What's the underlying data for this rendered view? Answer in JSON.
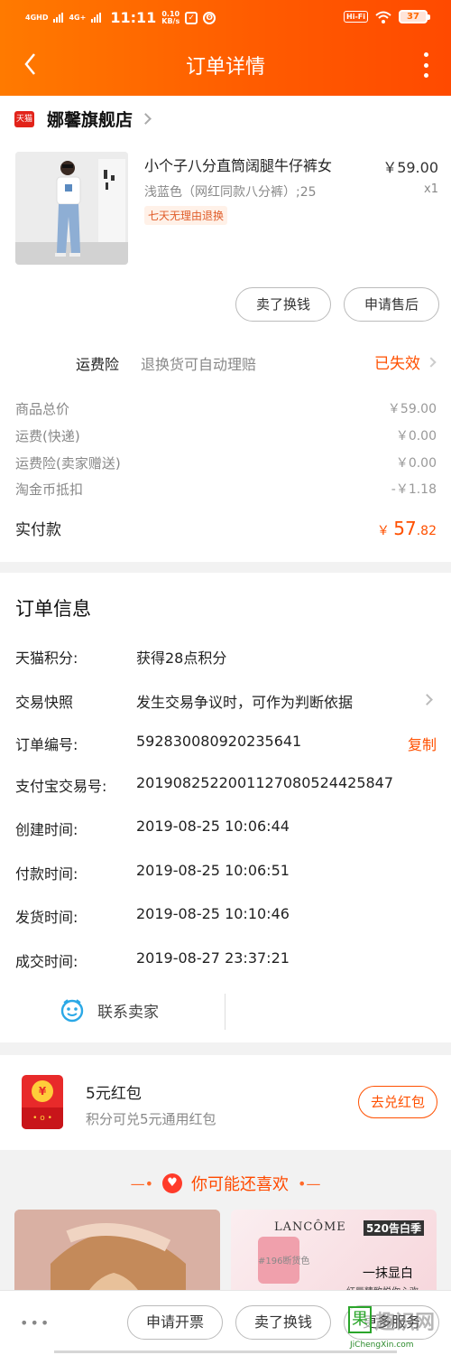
{
  "status_bar": {
    "net1": "4GHD",
    "net2": "4G+",
    "time": "11:11",
    "speed": "0.10",
    "speed_unit": "KB/s",
    "hifi": "Hi-Fi",
    "battery": "37"
  },
  "header": {
    "title": "订单详情"
  },
  "store": {
    "badge": "天猫",
    "name": "娜馨旗舰店"
  },
  "product": {
    "title": "小个子八分直筒阔腿牛仔裤女",
    "sku": "浅蓝色（网红同款八分裤）;25",
    "tag": "七天无理由退换",
    "price": "￥59.00",
    "qty": "x1",
    "sell_label": "卖了换钱",
    "after_sale_label": "申请售后"
  },
  "insurance": {
    "label": "运费险",
    "desc": "退换货可自动理赔",
    "status": "已失效"
  },
  "fees": [
    {
      "label": "商品总价",
      "value": "￥59.00"
    },
    {
      "label": "运费(快递)",
      "value": "￥0.00"
    },
    {
      "label": "运费险(卖家赠送)",
      "value": "￥0.00"
    },
    {
      "label": "淘金币抵扣",
      "value": "-￥1.18"
    }
  ],
  "paid": {
    "label": "实付款",
    "currency": "￥",
    "integer": "57",
    "decimal": ".82"
  },
  "order_info": {
    "title": "订单信息",
    "points_label": "天猫积分:",
    "points_value": "获得28点积分",
    "snapshot_label": "交易快照",
    "snapshot_value": "发生交易争议时，可作为判断依据",
    "order_no_label": "订单编号:",
    "order_no": "592830080920235641",
    "copy_label": "复制",
    "alipay_label": "支付宝交易号:",
    "alipay_no": "2019082522001127080524425847",
    "created_label": "创建时间:",
    "created": "2019-08-25 10:06:44",
    "paid_label": "付款时间:",
    "paid_time": "2019-08-25 10:06:51",
    "shipped_label": "发货时间:",
    "shipped": "2019-08-25 10:10:46",
    "closed_label": "成交时间:",
    "closed": "2019-08-27 23:37:21",
    "contact_label": "联系卖家"
  },
  "red_packet": {
    "coin": "¥",
    "title": "5元红包",
    "subtitle": "积分可兑5元通用红包",
    "button": "去兑红包"
  },
  "recommend": {
    "title": "你可能还喜欢",
    "card2_brand": "LANCÔME",
    "card2_badge": "520告白季",
    "card2_tag": "#196断货色",
    "card2_headline": "一抹显白",
    "card2_sub": "红唇精致悦你心欢"
  },
  "bottom_bar": {
    "more": "•••",
    "invoice_label": "申请开票",
    "sell_label": "卖了换钱",
    "service_label": "更多服务",
    "watermark": "趣识网",
    "watermark_url": "JiChengXin.com"
  },
  "colors": {
    "brand_orange": "#ff5a00",
    "price_red": "#ff5000",
    "tmall_red": "#e2231a"
  }
}
